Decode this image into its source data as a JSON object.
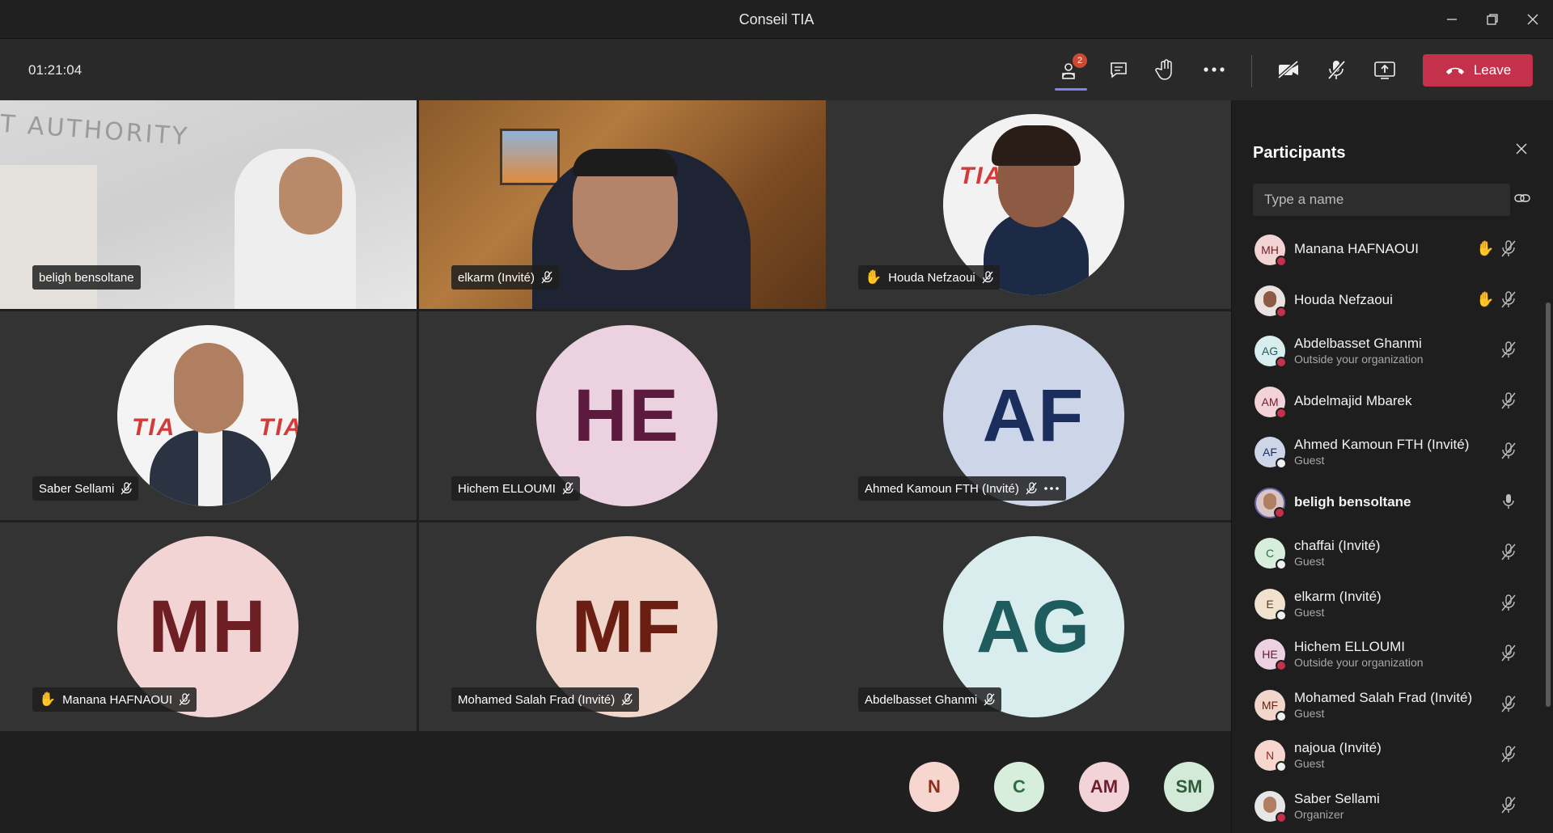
{
  "window": {
    "title": "Conseil TIA"
  },
  "toolbar": {
    "timer": "01:21:04",
    "participants_count": "2",
    "leave_label": "Leave"
  },
  "grid": [
    {
      "name": "beligh bensoltane",
      "type": "video1",
      "muted": false,
      "hand": false
    },
    {
      "name": "elkarm (Invité)",
      "type": "video2",
      "muted": true,
      "hand": false
    },
    {
      "name": "Houda Nefzaoui",
      "type": "photo-houda",
      "muted": true,
      "hand": true
    },
    {
      "name": "Saber Sellami",
      "type": "photo-saber",
      "muted": true,
      "hand": false
    },
    {
      "name": "Hichem ELLOUMI",
      "initials": "HE",
      "bg": "#ecd2e0",
      "fg": "#5c1b3e",
      "muted": true,
      "hand": false
    },
    {
      "name": "Ahmed Kamoun FTH (Invité)",
      "initials": "AF",
      "bg": "#cdd6e8",
      "fg": "#1b2d5c",
      "muted": true,
      "hand": false,
      "more": true
    },
    {
      "name": "Manana HAFNAOUI",
      "initials": "MH",
      "bg": "#f3d4d4",
      "fg": "#6e1f24",
      "muted": true,
      "hand": true
    },
    {
      "name": "Mohamed Salah Frad (Invité)",
      "initials": "MF",
      "bg": "#f1d6cc",
      "fg": "#6b1e12",
      "muted": true,
      "hand": false
    },
    {
      "name": "Abdelbasset Ghanmi",
      "initials": "AG",
      "bg": "#d9edee",
      "fg": "#1f5c5e",
      "muted": true,
      "hand": false
    }
  ],
  "overflow": [
    {
      "initials": "N",
      "bg": "#f6d6cf",
      "fg": "#8a2e1e"
    },
    {
      "initials": "C",
      "bg": "#d7eedd",
      "fg": "#2f6e40"
    },
    {
      "initials": "AM",
      "bg": "#f2d3d8",
      "fg": "#6e1f2b"
    },
    {
      "initials": "SM",
      "bg": "#d4ead9",
      "fg": "#2f5c3a"
    }
  ],
  "panel": {
    "title": "Participants",
    "search_placeholder": "Type a name",
    "participants": [
      {
        "name": "Manana HAFNAOUI",
        "sub": "",
        "initials": "MH",
        "bg": "#f3d4d4",
        "fg": "#6e1f24",
        "status": "#c4314b",
        "hand": true,
        "mic": "muted"
      },
      {
        "name": "Houda Nefzaoui",
        "sub": "",
        "initials": "",
        "photo": "houda",
        "status": "#c4314b",
        "hand": true,
        "mic": "muted"
      },
      {
        "name": "Abdelbasset Ghanmi",
        "sub": "Outside your organization",
        "initials": "AG",
        "bg": "#d9edee",
        "fg": "#1f5c5e",
        "status": "#c4314b",
        "hand": false,
        "mic": "muted"
      },
      {
        "name": "Abdelmajid Mbarek",
        "sub": "",
        "initials": "AM",
        "bg": "#f2d3d8",
        "fg": "#6e1f2b",
        "status": "#c4314b",
        "hand": false,
        "mic": "muted"
      },
      {
        "name": "Ahmed Kamoun FTH (Invité)",
        "sub": "Guest",
        "initials": "AF",
        "bg": "#cdd6e8",
        "fg": "#1b2d5c",
        "status": "#f0f0f0",
        "hand": false,
        "mic": "muted"
      },
      {
        "name": "beligh bensoltane",
        "sub": "",
        "initials": "",
        "photo": "beligh",
        "status": "#c4314b",
        "hand": false,
        "mic": "on",
        "bold": true
      },
      {
        "name": "chaffai (Invité)",
        "sub": "Guest",
        "initials": "C",
        "bg": "#d7eedd",
        "fg": "#2f6e40",
        "status": "#f0f0f0",
        "hand": false,
        "mic": "muted"
      },
      {
        "name": "elkarm (Invité)",
        "sub": "Guest",
        "initials": "E",
        "bg": "#f0e2cf",
        "fg": "#5c3b17",
        "status": "#f0f0f0",
        "hand": false,
        "mic": "muted"
      },
      {
        "name": "Hichem ELLOUMI",
        "sub": "Outside your organization",
        "initials": "HE",
        "bg": "#ecd2e0",
        "fg": "#5c1b3e",
        "status": "#c4314b",
        "hand": false,
        "mic": "muted"
      },
      {
        "name": "Mohamed Salah Frad (Invité)",
        "sub": "Guest",
        "initials": "MF",
        "bg": "#f1d6cc",
        "fg": "#6b1e12",
        "status": "#f0f0f0",
        "hand": false,
        "mic": "muted"
      },
      {
        "name": "najoua (Invité)",
        "sub": "Guest",
        "initials": "N",
        "bg": "#f6d6cf",
        "fg": "#8a2e1e",
        "status": "#f0f0f0",
        "hand": false,
        "mic": "muted"
      },
      {
        "name": "Saber Sellami",
        "sub": "Organizer",
        "initials": "",
        "photo": "saber",
        "status": "#c4314b",
        "hand": false,
        "mic": "muted"
      }
    ]
  }
}
